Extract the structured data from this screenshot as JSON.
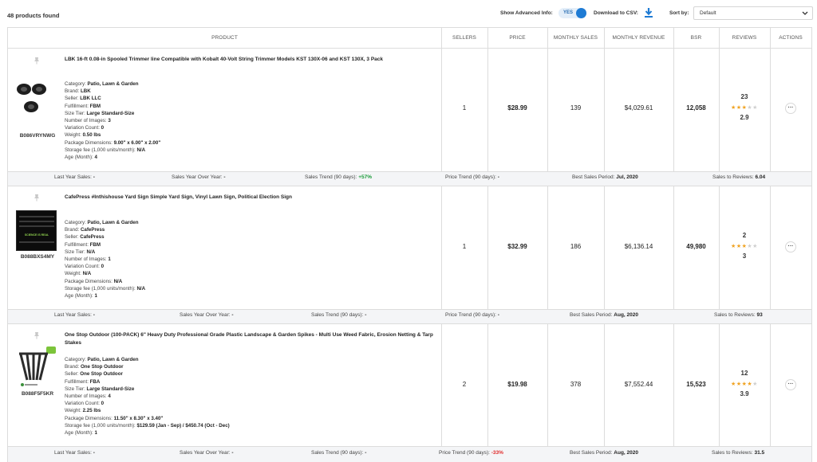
{
  "toolbar": {
    "products_found": "48 products found",
    "advanced_info_label": "Show Advanced Info:",
    "advanced_info_value": "YES",
    "download_label": "Download to CSV:",
    "sort_label": "Sort by:",
    "sort_value": "Default"
  },
  "columns": [
    "PRODUCT",
    "SELLERS",
    "PRICE",
    "MONTHLY SALES",
    "MONTHLY REVENUE",
    "BSR",
    "REVIEWS",
    "ACTIONS"
  ],
  "products": [
    {
      "title": "LBK 16-ft 0.08-in Spooled Trimmer line Compatible with Kobalt 40-Volt String Trimmer Models KST 130X-06 and KST 130X, 3 Pack",
      "asin": "B086VRYNWG",
      "thumb_icon": "trimmer-spools-image",
      "details": [
        {
          "label": "Category: ",
          "value": "Patio, Lawn & Garden"
        },
        {
          "label": "Brand: ",
          "value": "LBK"
        },
        {
          "label": "Seller: ",
          "value": "LBK LLC"
        },
        {
          "label": "Fulfillment: ",
          "value": "FBM"
        },
        {
          "label": "Size Tier: ",
          "value": "Large Standard-Size"
        },
        {
          "label": "Number of Images: ",
          "value": "3"
        },
        {
          "label": "Variation Count: ",
          "value": "0"
        },
        {
          "label": "Weight: ",
          "value": "0.50 lbs"
        },
        {
          "label": "Package Dimensions: ",
          "value": "9.00\" x 6.00\" x 2.00\""
        },
        {
          "label": "Storage fee (1,000 units/month): ",
          "value": "N/A"
        },
        {
          "label": "Age (Month): ",
          "value": "4"
        }
      ],
      "sellers": "1",
      "price": "$28.99",
      "monthly_sales": "139",
      "monthly_revenue": "$4,029.61",
      "bsr": "12,058",
      "reviews_count": "23",
      "rating": "2.9",
      "stars_filled": 3,
      "summary": {
        "last_year_label": "Last Year Sales:",
        "last_year_value": "-",
        "yoy_label": "Sales Year Over Year:",
        "yoy_value": "-",
        "trend_label": "Sales Trend (90 days):",
        "trend_value": "+57%",
        "price_trend_label": "Price Trend (90 days):",
        "price_trend_value": "-",
        "best_period_label": "Best Sales Period:",
        "best_period_value": "Jul, 2020",
        "s2r_label": "Sales to Reviews:",
        "s2r_value": "6.04"
      }
    },
    {
      "title": "CafePress #Inthishouse Yard Sign Simple Yard Sign, Vinyl Lawn Sign, Political Election Sign",
      "asin": "B088BXS4MY",
      "thumb_icon": "yard-sign-image",
      "thumb_text": [
        "SCIENCE IS REAL"
      ],
      "details": [
        {
          "label": "Category: ",
          "value": "Patio, Lawn & Garden"
        },
        {
          "label": "Brand: ",
          "value": "CafePress"
        },
        {
          "label": "Seller: ",
          "value": "CafePress"
        },
        {
          "label": "Fulfillment: ",
          "value": "FBM"
        },
        {
          "label": "Size Tier: ",
          "value": "N/A"
        },
        {
          "label": "Number of Images: ",
          "value": "1"
        },
        {
          "label": "Variation Count: ",
          "value": "0"
        },
        {
          "label": "Weight: ",
          "value": "N/A"
        },
        {
          "label": "Package Dimensions: ",
          "value": "N/A"
        },
        {
          "label": "Storage fee (1,000 units/month): ",
          "value": "N/A"
        },
        {
          "label": "Age (Month): ",
          "value": "1"
        }
      ],
      "sellers": "1",
      "price": "$32.99",
      "monthly_sales": "186",
      "monthly_revenue": "$6,136.14",
      "bsr": "49,980",
      "reviews_count": "2",
      "rating": "3",
      "stars_filled": 3,
      "summary": {
        "last_year_label": "Last Year Sales:",
        "last_year_value": "-",
        "yoy_label": "Sales Year Over Year:",
        "yoy_value": "-",
        "trend_label": "Sales Trend (90 days):",
        "trend_value": "-",
        "price_trend_label": "Price Trend (90 days):",
        "price_trend_value": "-",
        "best_period_label": "Best Sales Period:",
        "best_period_value": "Aug, 2020",
        "s2r_label": "Sales to Reviews:",
        "s2r_value": "93"
      }
    },
    {
      "title": "One Stop Outdoor (100-PACK) 6\" Heavy Duty Professional Grade Plastic Landscape & Garden Spikes - Multi Use Weed Fabric, Erosion Netting & Tarp Stakes",
      "asin": "B088F5F5KR",
      "thumb_icon": "garden-spikes-image",
      "details": [
        {
          "label": "Category: ",
          "value": "Patio, Lawn & Garden"
        },
        {
          "label": "Brand: ",
          "value": "One Stop Outdoor"
        },
        {
          "label": "Seller: ",
          "value": "One Stop Outdoor"
        },
        {
          "label": "Fulfillment: ",
          "value": "FBA"
        },
        {
          "label": "Size Tier: ",
          "value": "Large Standard-Size"
        },
        {
          "label": "Number of Images: ",
          "value": "4"
        },
        {
          "label": "Variation Count: ",
          "value": "0"
        },
        {
          "label": "Weight: ",
          "value": "2.25 lbs"
        },
        {
          "label": "Package Dimensions: ",
          "value": "11.50\" x 8.30\" x 3.40\""
        },
        {
          "label": "Storage fee (1,000 units/month): ",
          "value": "$129.59 (Jan - Sep) / $450.74 (Oct - Dec)"
        },
        {
          "label": "Age (Month): ",
          "value": "1"
        }
      ],
      "sellers": "2",
      "price": "$19.98",
      "monthly_sales": "378",
      "monthly_revenue": "$7,552.44",
      "bsr": "15,523",
      "reviews_count": "12",
      "rating": "3.9",
      "stars_filled": 4,
      "summary": {
        "last_year_label": "Last Year Sales:",
        "last_year_value": "-",
        "yoy_label": "Sales Year Over Year:",
        "yoy_value": "-",
        "trend_label": "Sales Trend (90 days):",
        "trend_value": "-",
        "price_trend_label": "Price Trend (90 days):",
        "price_trend_value": "-33%",
        "best_period_label": "Best Sales Period:",
        "best_period_value": "Aug, 2020",
        "s2r_label": "Sales to Reviews:",
        "s2r_value": "31.5"
      }
    }
  ],
  "colors": {
    "accent": "#1e7bd4",
    "star": "#f0a322",
    "trend_up": "#1a9b38",
    "trend_down": "#e02b2b"
  }
}
